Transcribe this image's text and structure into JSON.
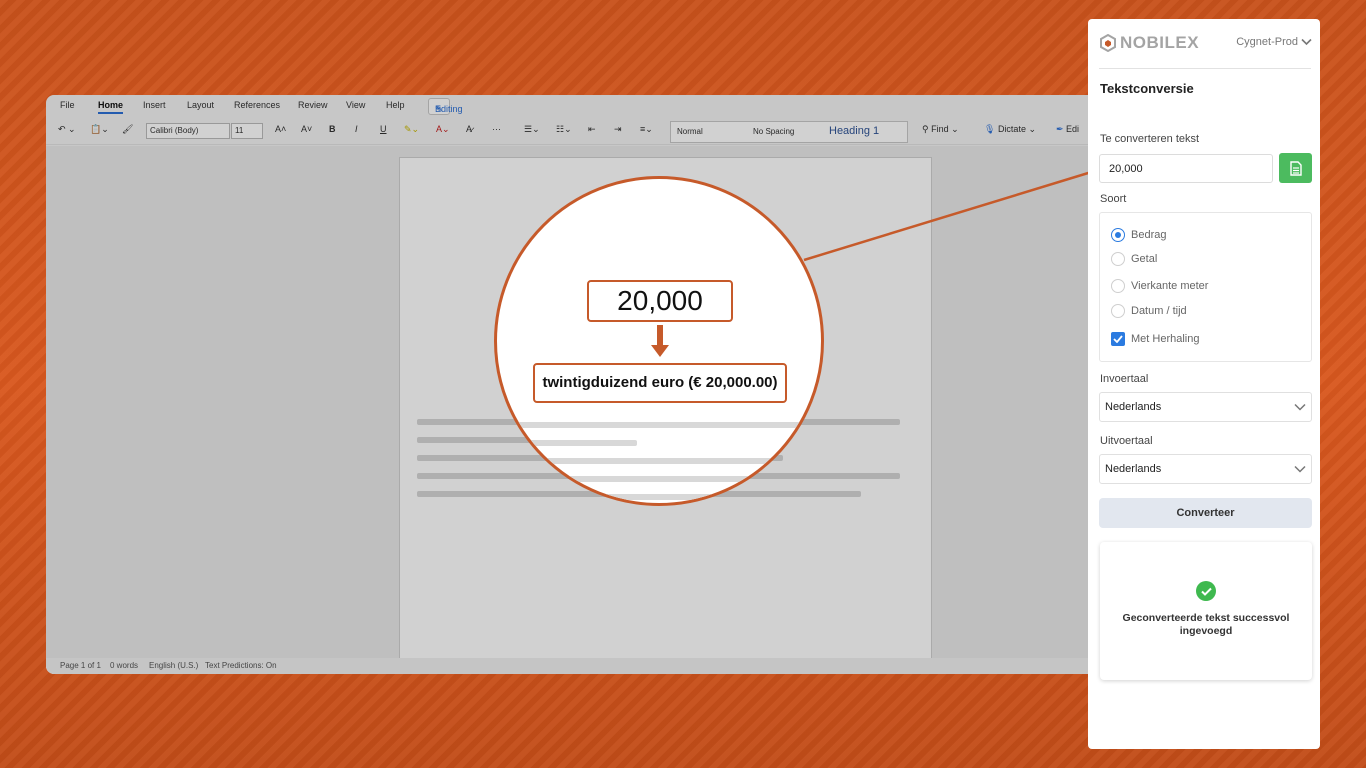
{
  "word": {
    "menu": [
      "File",
      "Home",
      "Insert",
      "Layout",
      "References",
      "Review",
      "View",
      "Help"
    ],
    "editing_label": "Editing",
    "font_name": "Calibri (Body)",
    "font_size": "11",
    "styles": [
      "Normal",
      "No Spacing",
      "Heading 1"
    ],
    "find_label": "Find",
    "dictate_label": "Dictate",
    "edit_label": "Edi",
    "status": [
      "Page 1 of 1",
      "0 words",
      "English (U.S.)",
      "Text Predictions: On"
    ]
  },
  "callout": {
    "input_text": "20,000",
    "output_text": "twintigduizend euro (€ 20,000.00)"
  },
  "panel": {
    "logo_text": "NOBILEX",
    "environment": "Cygnet-Prod",
    "title": "Tekstconversie",
    "input_label": "Te converteren tekst",
    "input_value": "20,000",
    "type_label": "Soort",
    "options": [
      {
        "label": "Bedrag",
        "selected": true
      },
      {
        "label": "Getal",
        "selected": false
      },
      {
        "label": "Vierkante meter",
        "selected": false
      },
      {
        "label": "Datum / tijd",
        "selected": false
      }
    ],
    "repeat_label": "Met Herhaling",
    "repeat_checked": true,
    "input_lang_label": "Invoertaal",
    "input_lang": "Nederlands",
    "output_lang_label": "Uitvoertaal",
    "output_lang": "Nederlands",
    "convert_label": "Converteer",
    "success_message": "Geconverteerde tekst successvol ingevoegd"
  },
  "colors": {
    "background": "#d9581f",
    "accent": "#c65a2a",
    "success": "#3fb94f",
    "primary": "#2b7be0"
  }
}
